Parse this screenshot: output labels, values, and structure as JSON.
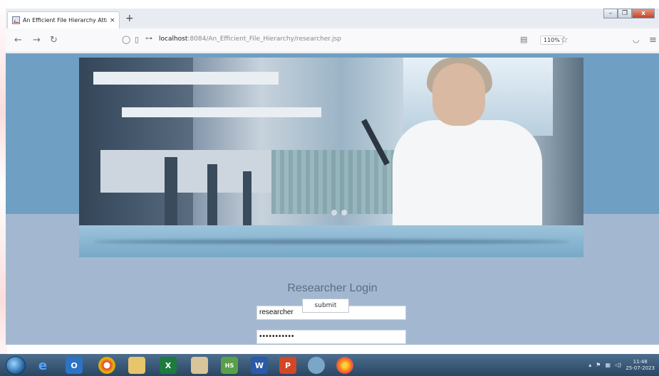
{
  "browser": {
    "tab_title": "An Efficient File Hierarchy Attri",
    "tab_close": "×",
    "new_tab": "+",
    "url_host": "localhost",
    "url_path": ":8084/An_Efficient_File_Hierarchy/researcher.jsp",
    "zoom": "110%",
    "icons": [
      "back-icon",
      "forward-icon",
      "reload-icon",
      "shield-icon",
      "page-icon",
      "key-icon",
      "reader-icon",
      "star-icon",
      "pocket-icon",
      "menu-icon"
    ]
  },
  "page": {
    "login_title": "Researcher Login",
    "username_value": "researcher",
    "password_value": "•••••••••••",
    "submit_label": "submit"
  },
  "taskbar": {
    "apps": [
      "ie-icon",
      "outlook-icon",
      "chrome-icon",
      "folder-icon",
      "excel-icon",
      "paint-icon",
      "hs-icon",
      "word-icon",
      "powerpoint-icon",
      "box-icon",
      "firefox-icon"
    ],
    "time": "11:48",
    "date": "25-07-2023"
  }
}
